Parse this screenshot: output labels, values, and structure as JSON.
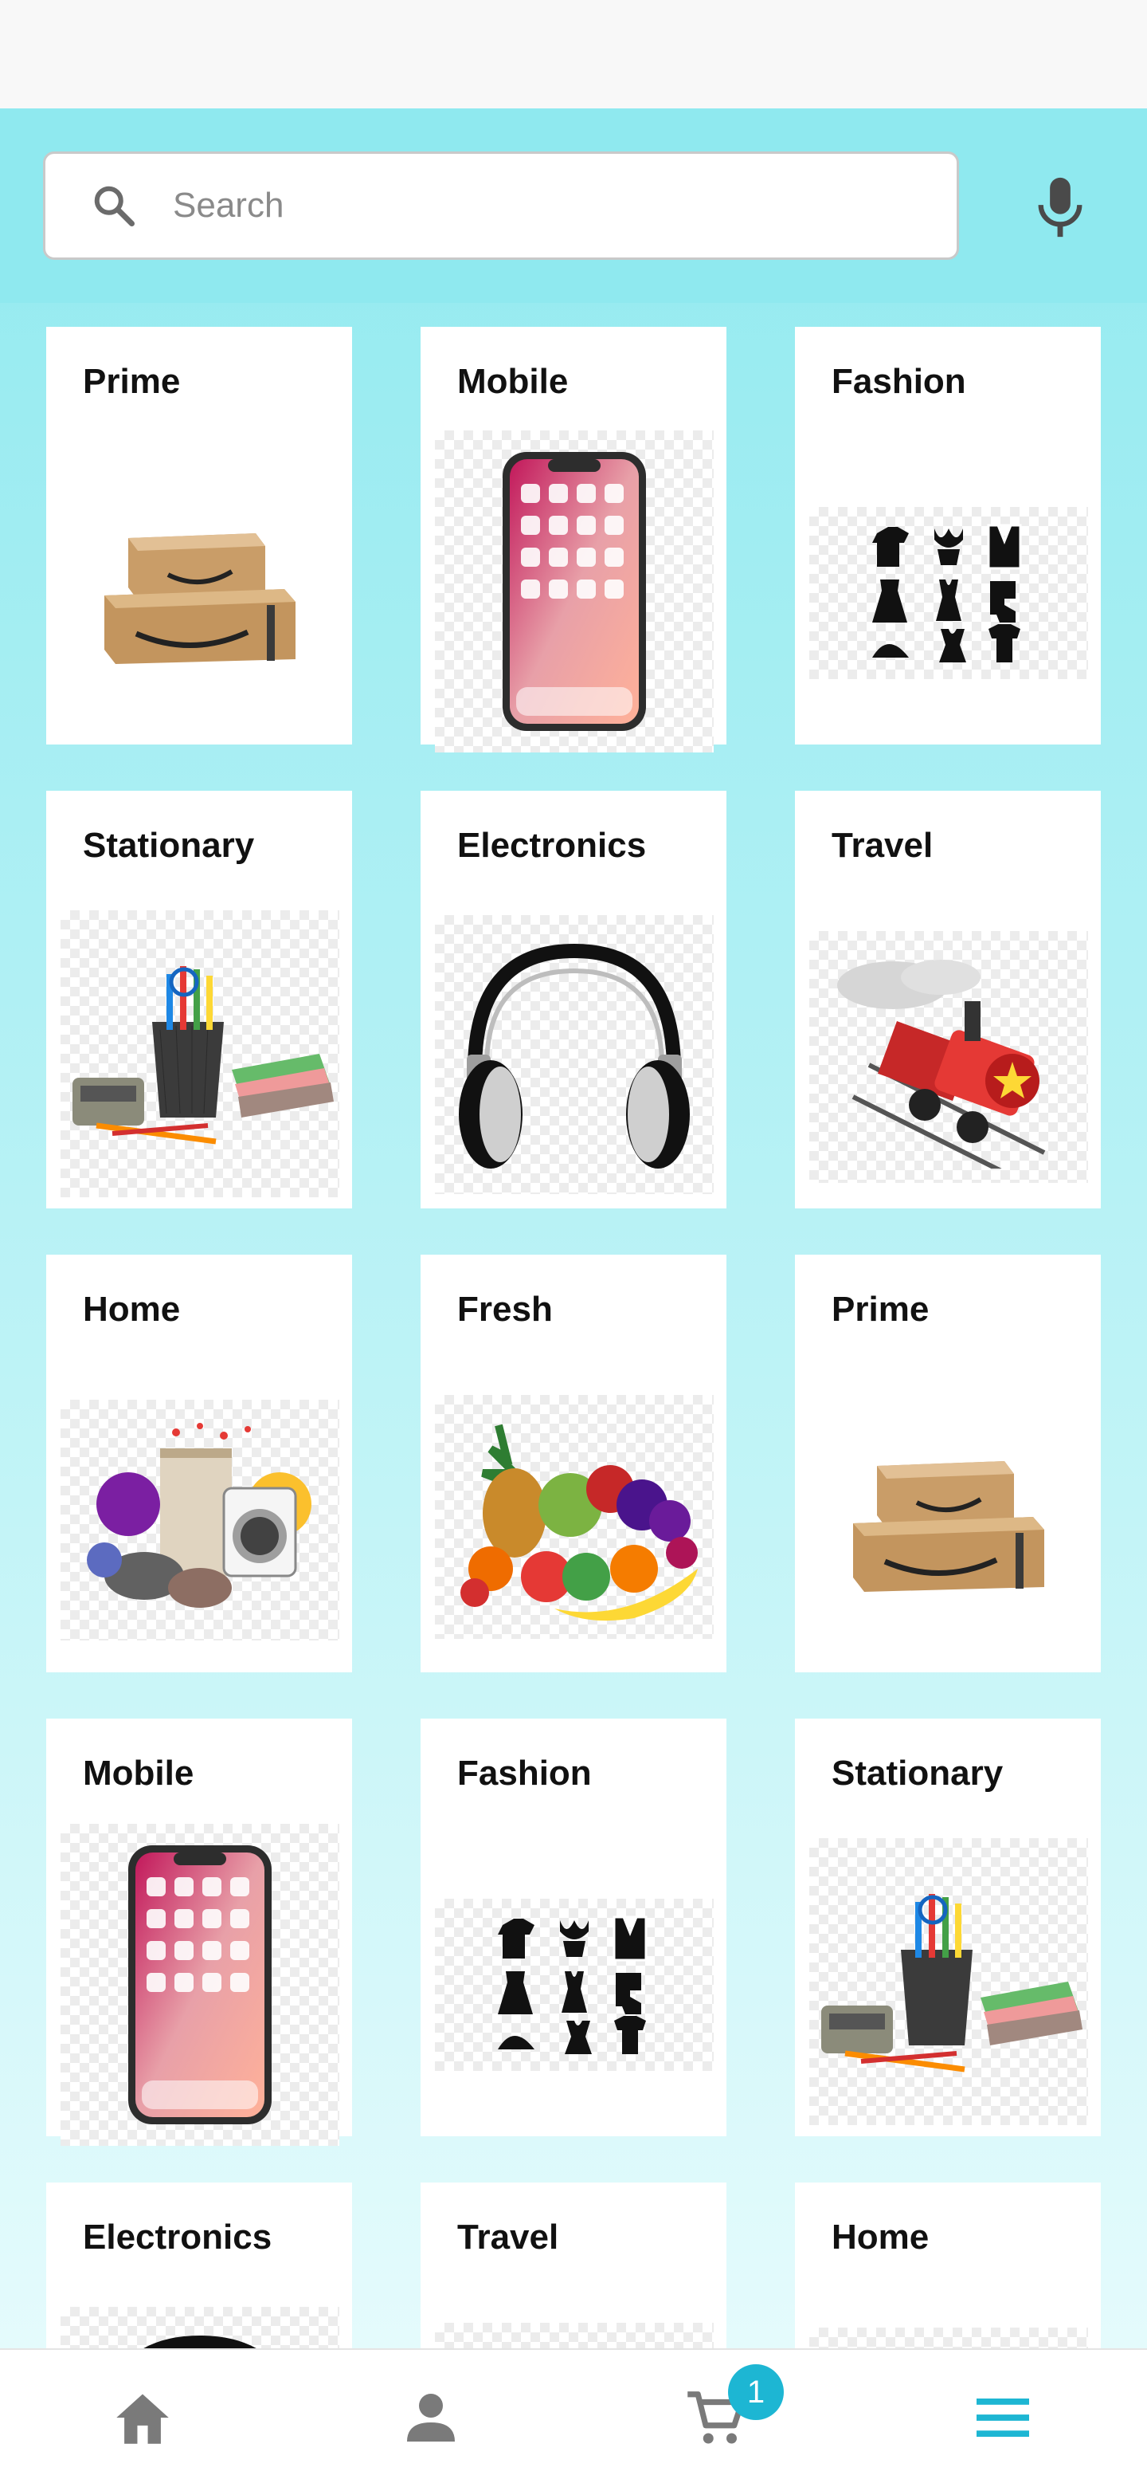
{
  "search": {
    "placeholder": "Search"
  },
  "categories": [
    {
      "label": "Prime",
      "icon": "amazon-boxes"
    },
    {
      "label": "Mobile",
      "icon": "smartphone"
    },
    {
      "label": "Fashion",
      "icon": "clothing-icons"
    },
    {
      "label": "Stationary",
      "icon": "stationery-set"
    },
    {
      "label": "Electronics",
      "icon": "headphones"
    },
    {
      "label": "Travel",
      "icon": "train"
    },
    {
      "label": "Home",
      "icon": "home-appliances"
    },
    {
      "label": "Fresh",
      "icon": "fruits"
    },
    {
      "label": "Prime",
      "icon": "amazon-boxes"
    },
    {
      "label": "Mobile",
      "icon": "smartphone"
    },
    {
      "label": "Fashion",
      "icon": "clothing-icons"
    },
    {
      "label": "Stationary",
      "icon": "stationery-set"
    },
    {
      "label": "Electronics",
      "icon": "headphones"
    },
    {
      "label": "Travel",
      "icon": "train"
    },
    {
      "label": "Home",
      "icon": "home-appliances"
    }
  ],
  "bottom_nav": {
    "items": [
      "home-icon",
      "profile-icon",
      "cart-icon",
      "menu-icon"
    ],
    "cart_count": "1",
    "active": "menu-icon",
    "active_color": "#1db6d3",
    "inactive_color": "#7a7a7a"
  },
  "colors": {
    "header": "#8fe9ef",
    "accent": "#1db6d3"
  }
}
